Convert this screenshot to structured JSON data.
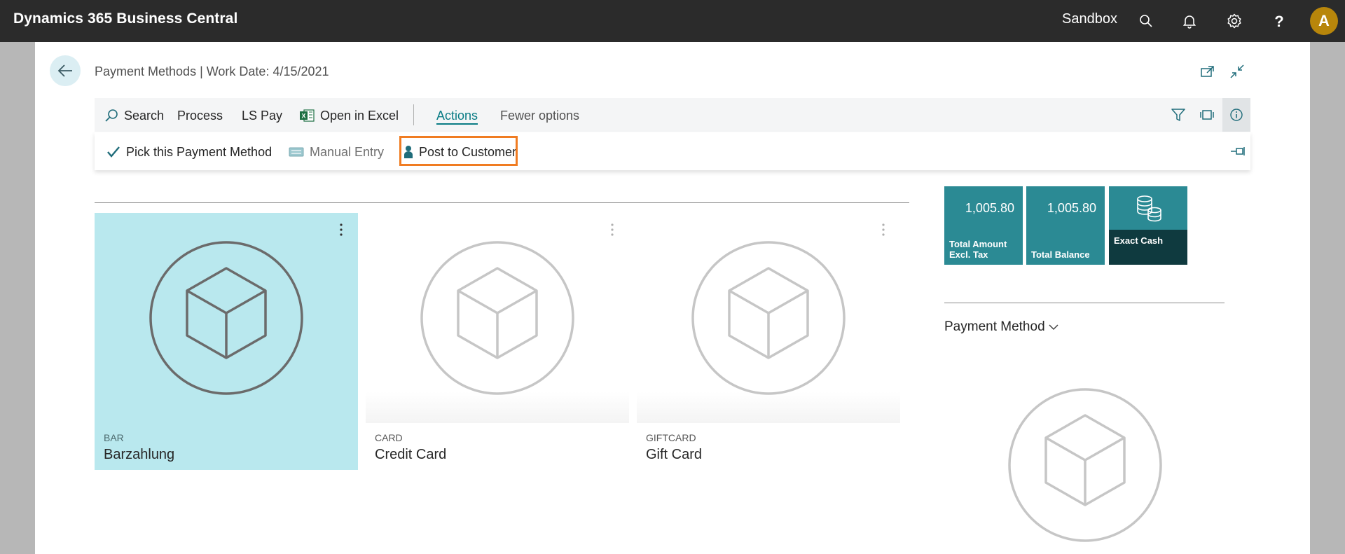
{
  "app": {
    "title": "Dynamics 365 Business Central",
    "environment": "Sandbox",
    "user_initial": "A",
    "icons": [
      "search-icon",
      "bell-icon",
      "gear-icon",
      "help-icon"
    ]
  },
  "page": {
    "caption": "Payment Methods | Work Date: 4/15/2021"
  },
  "actionbar": {
    "search": "Search",
    "process": "Process",
    "ls_pay": "LS Pay",
    "open_in_excel": "Open in Excel",
    "actions": "Actions",
    "fewer_options": "Fewer options"
  },
  "actions_row": {
    "pick": "Pick this Payment Method",
    "manual_entry": "Manual Entry",
    "post_to_customer": "Post to Customer"
  },
  "tiles": [
    {
      "code": "BAR",
      "name": "Barzahlung",
      "selected": true
    },
    {
      "code": "CARD",
      "name": "Credit Card",
      "selected": false
    },
    {
      "code": "GIFTCARD",
      "name": "Gift Card",
      "selected": false
    }
  ],
  "cues": {
    "total_amount_value": "1,005.80",
    "total_amount_label_1": "Total Amount",
    "total_amount_label_2": "Excl. Tax",
    "total_balance_value": "1,005.80",
    "total_balance_label": "Total Balance",
    "exact_cash_label": "Exact Cash"
  },
  "factbox": {
    "title": "Payment Method"
  },
  "colors": {
    "accent": "#0a7c85",
    "cue": "#2b8a94",
    "cue_dark": "#0f3a3f",
    "selected_tile": "#b9e8ee",
    "highlight": "#f07c22",
    "avatar": "#b8860b"
  }
}
